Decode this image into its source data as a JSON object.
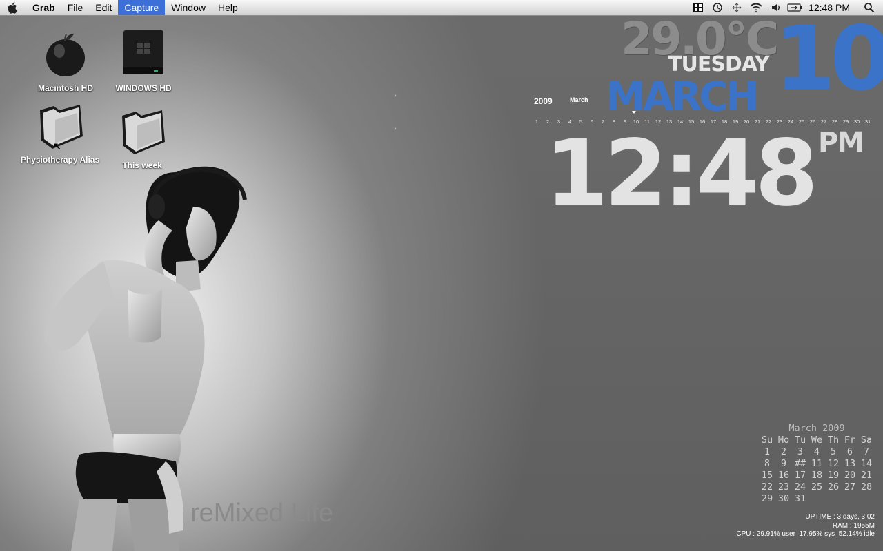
{
  "menubar": {
    "app_name": "Grab",
    "items": [
      "File",
      "Edit",
      "Capture",
      "Window",
      "Help"
    ],
    "active_item": "Capture",
    "clock": "12:48 PM"
  },
  "desktop": {
    "icons": [
      {
        "label": "Macintosh HD"
      },
      {
        "label": "WINDOWS HD"
      },
      {
        "label": "Physiotherapy Alias"
      },
      {
        "label": "This week"
      }
    ],
    "brand_text": "reMixed Life"
  },
  "widgets": {
    "temperature": "29.0°C",
    "weekday": "TUESDAY",
    "month": "MARCH",
    "day": "10",
    "time": "12:48",
    "ampm": "PM",
    "year": "2009",
    "month_small": "March",
    "days": [
      "1",
      "2",
      "3",
      "4",
      "5",
      "6",
      "7",
      "8",
      "9",
      "10",
      "11",
      "12",
      "13",
      "14",
      "15",
      "16",
      "17",
      "18",
      "19",
      "20",
      "21",
      "22",
      "23",
      "24",
      "25",
      "26",
      "27",
      "28",
      "29",
      "30",
      "31"
    ]
  },
  "calendar": {
    "title": "March 2009",
    "header": [
      "Su",
      "Mo",
      "Tu",
      "We",
      "Th",
      "Fr",
      "Sa"
    ],
    "weeks": [
      [
        "1",
        "2",
        "3",
        "4",
        "5",
        "6",
        "7"
      ],
      [
        "8",
        "9",
        "##",
        "11",
        "12",
        "13",
        "14"
      ],
      [
        "15",
        "16",
        "17",
        "18",
        "19",
        "20",
        "21"
      ],
      [
        "22",
        "23",
        "24",
        "25",
        "26",
        "27",
        "28"
      ],
      [
        "29",
        "30",
        "31",
        "",
        "",
        "",
        ""
      ]
    ]
  },
  "stats": {
    "uptime": "UPTIME : 3 days, 3:02",
    "ram": "RAM : 1955M",
    "cpu": "CPU : 29.91% user  17.95% sys  52.14% idle"
  },
  "colors": {
    "accent_blue": "#3a73c8",
    "menu_highlight": "#3d6fd9"
  }
}
